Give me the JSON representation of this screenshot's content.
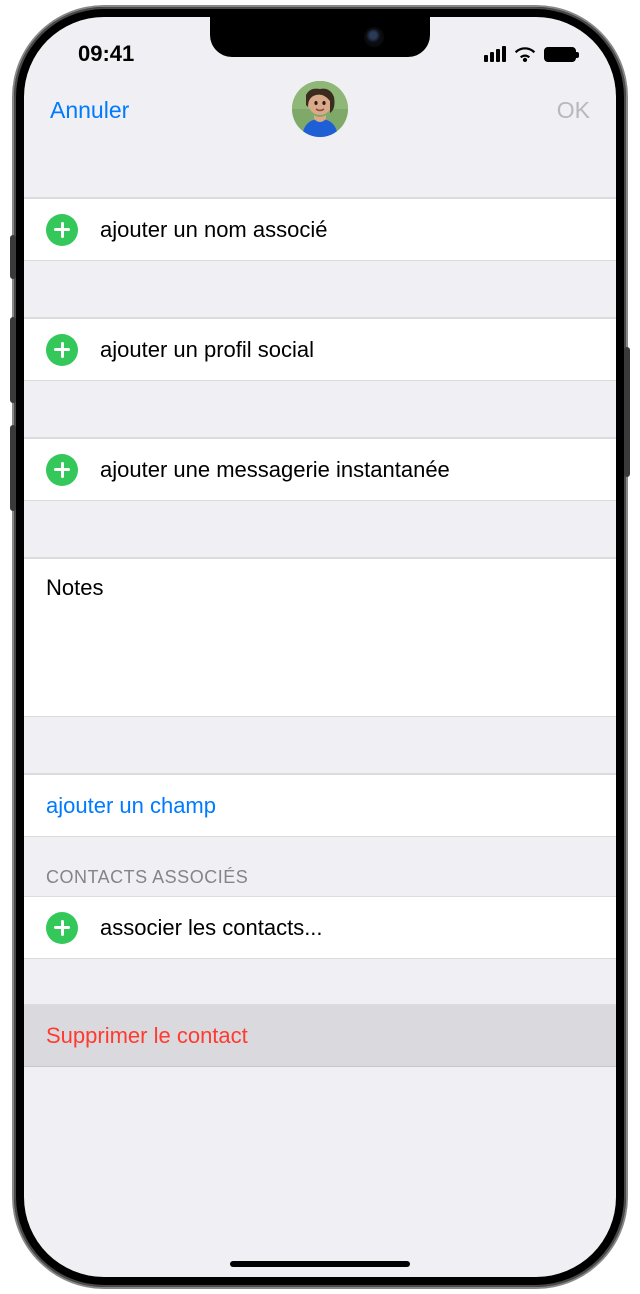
{
  "status": {
    "time": "09:41"
  },
  "nav": {
    "cancel": "Annuler",
    "ok": "OK"
  },
  "rows": {
    "add_related_name": "ajouter un nom associé",
    "add_social_profile": "ajouter un profil social",
    "add_instant_message": "ajouter une messagerie instantanée",
    "notes_label": "Notes",
    "add_field": "ajouter un champ",
    "linked_header": "CONTACTS ASSOCIÉS",
    "link_contacts": "associer les contacts...",
    "delete_contact": "Supprimer le contact"
  }
}
